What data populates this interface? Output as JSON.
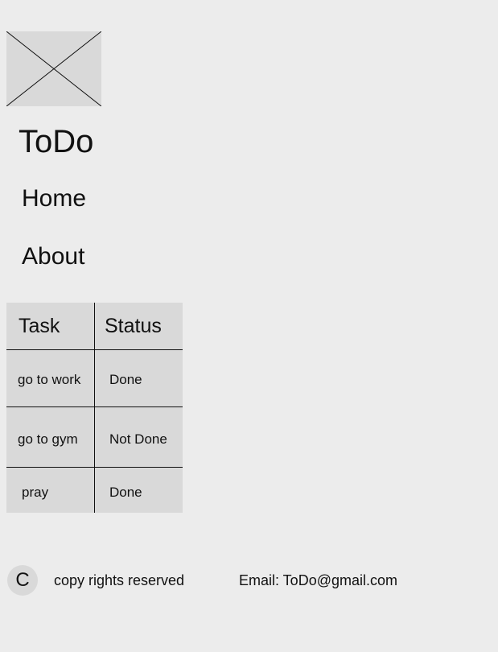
{
  "logo": {
    "icon": "image-placeholder-icon"
  },
  "header": {
    "title": "ToDo"
  },
  "nav": {
    "items": [
      {
        "label": "Home"
      },
      {
        "label": "About"
      }
    ]
  },
  "table": {
    "headers": [
      "Task",
      "Status"
    ],
    "rows": [
      {
        "task": "go to work",
        "status": "Done"
      },
      {
        "task": "go to gym",
        "status": "Not Done"
      },
      {
        "task": "pray",
        "status": "Done"
      }
    ]
  },
  "footer": {
    "badge": "C",
    "copyright": "copy rights reserved",
    "email": "Email: ToDo@gmail.com"
  },
  "colors": {
    "page_background": "#ececec",
    "placeholder_fill": "#d9d9d9",
    "text": "#111111"
  }
}
